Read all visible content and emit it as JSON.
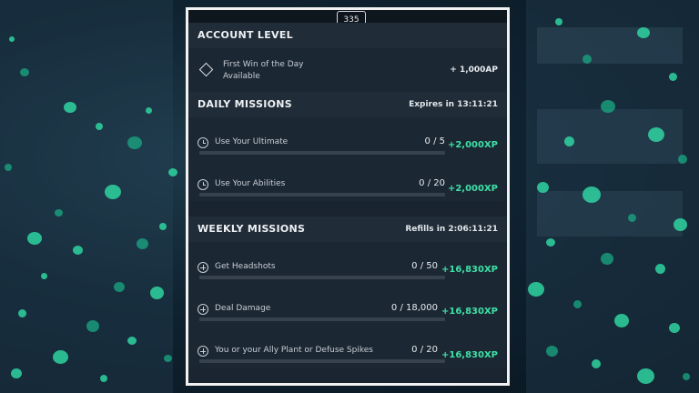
{
  "level_badge": "335",
  "account_level": {
    "title": "ACCOUNT LEVEL",
    "item_label_line1": "First Win of the Day",
    "item_label_line2": "Available",
    "item_reward": "+ 1,000AP"
  },
  "daily": {
    "title": "DAILY MISSIONS",
    "timer": "Expires in 13:11:21",
    "missions": [
      {
        "label": "Use Your Ultimate",
        "progress": "0 / 5",
        "reward": "+2,000XP",
        "fill": 0
      },
      {
        "label": "Use Your Abilities",
        "progress": "0 / 20",
        "reward": "+2,000XP",
        "fill": 0
      }
    ]
  },
  "weekly": {
    "title": "WEEKLY MISSIONS",
    "timer": "Refills in 2:06:11:21",
    "missions": [
      {
        "label": "Get Headshots",
        "progress": "0 / 50",
        "reward": "+16,830XP",
        "fill": 0
      },
      {
        "label": "Deal Damage",
        "progress": "0 / 18,000",
        "reward": "+16,830XP",
        "fill": 0
      },
      {
        "label": "You or your Ally Plant or Defuse Spikes",
        "progress": "0 / 20",
        "reward": "+16,830XP",
        "fill": 0
      }
    ]
  },
  "colors": {
    "accent": "#3fe0a7",
    "panel_border": "#f2f2f2",
    "track": "#37424e"
  },
  "icons": {
    "account_item": "diamond-icon",
    "daily_mission": "clock-icon",
    "weekly_mission": "plus-circle-icon"
  }
}
